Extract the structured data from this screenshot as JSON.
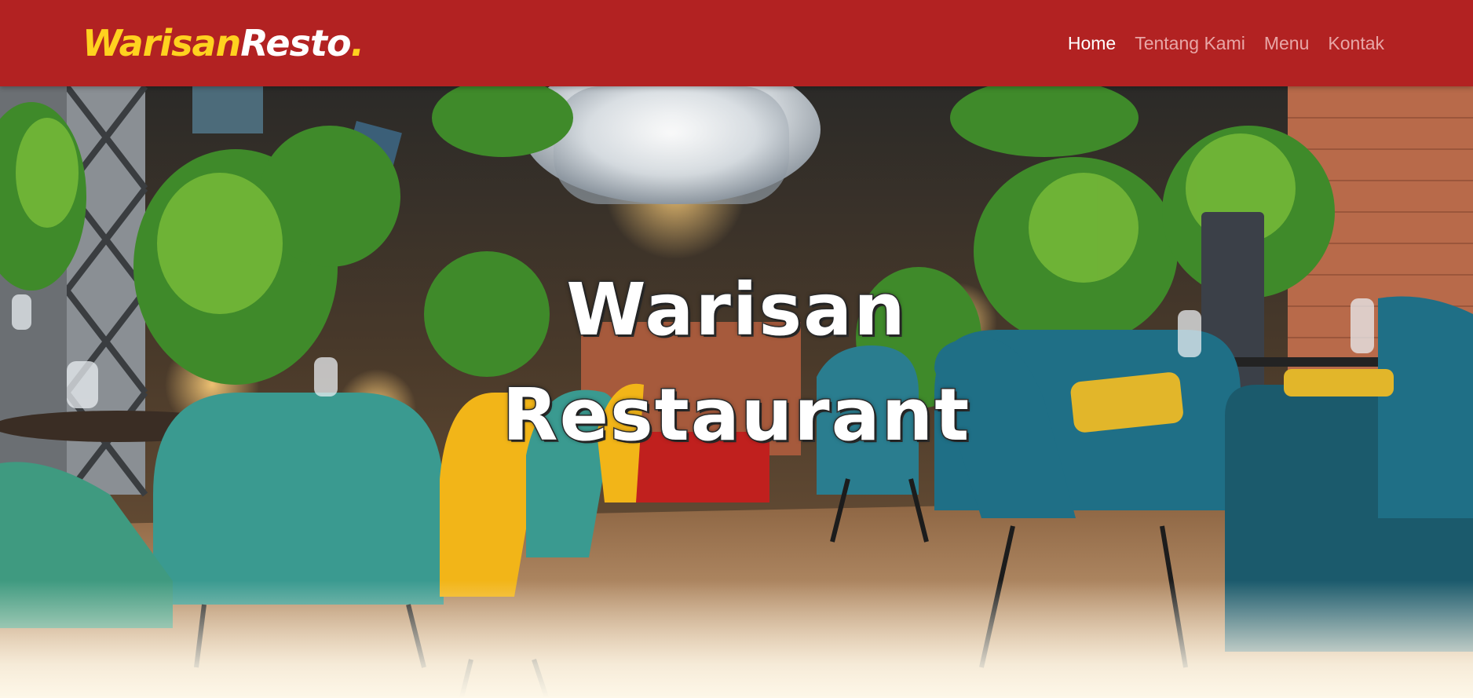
{
  "brand": {
    "part1": "Warisan",
    "part2": "Resto",
    "dot": "."
  },
  "nav": {
    "items": [
      {
        "label": "Home",
        "active": true
      },
      {
        "label": "Tentang Kami",
        "active": false
      },
      {
        "label": "Menu",
        "active": false
      },
      {
        "label": "Kontak",
        "active": false
      }
    ]
  },
  "hero": {
    "line1": "Warisan",
    "line2": "Restaurant",
    "image": "restaurant-interior-photo"
  },
  "colors": {
    "navbar": "#b22222",
    "brand_accent": "#ffd21f",
    "nav_active": "#ffffff",
    "nav_inactive": "#e8a6a6",
    "page_bg": "#fdf7e8"
  }
}
